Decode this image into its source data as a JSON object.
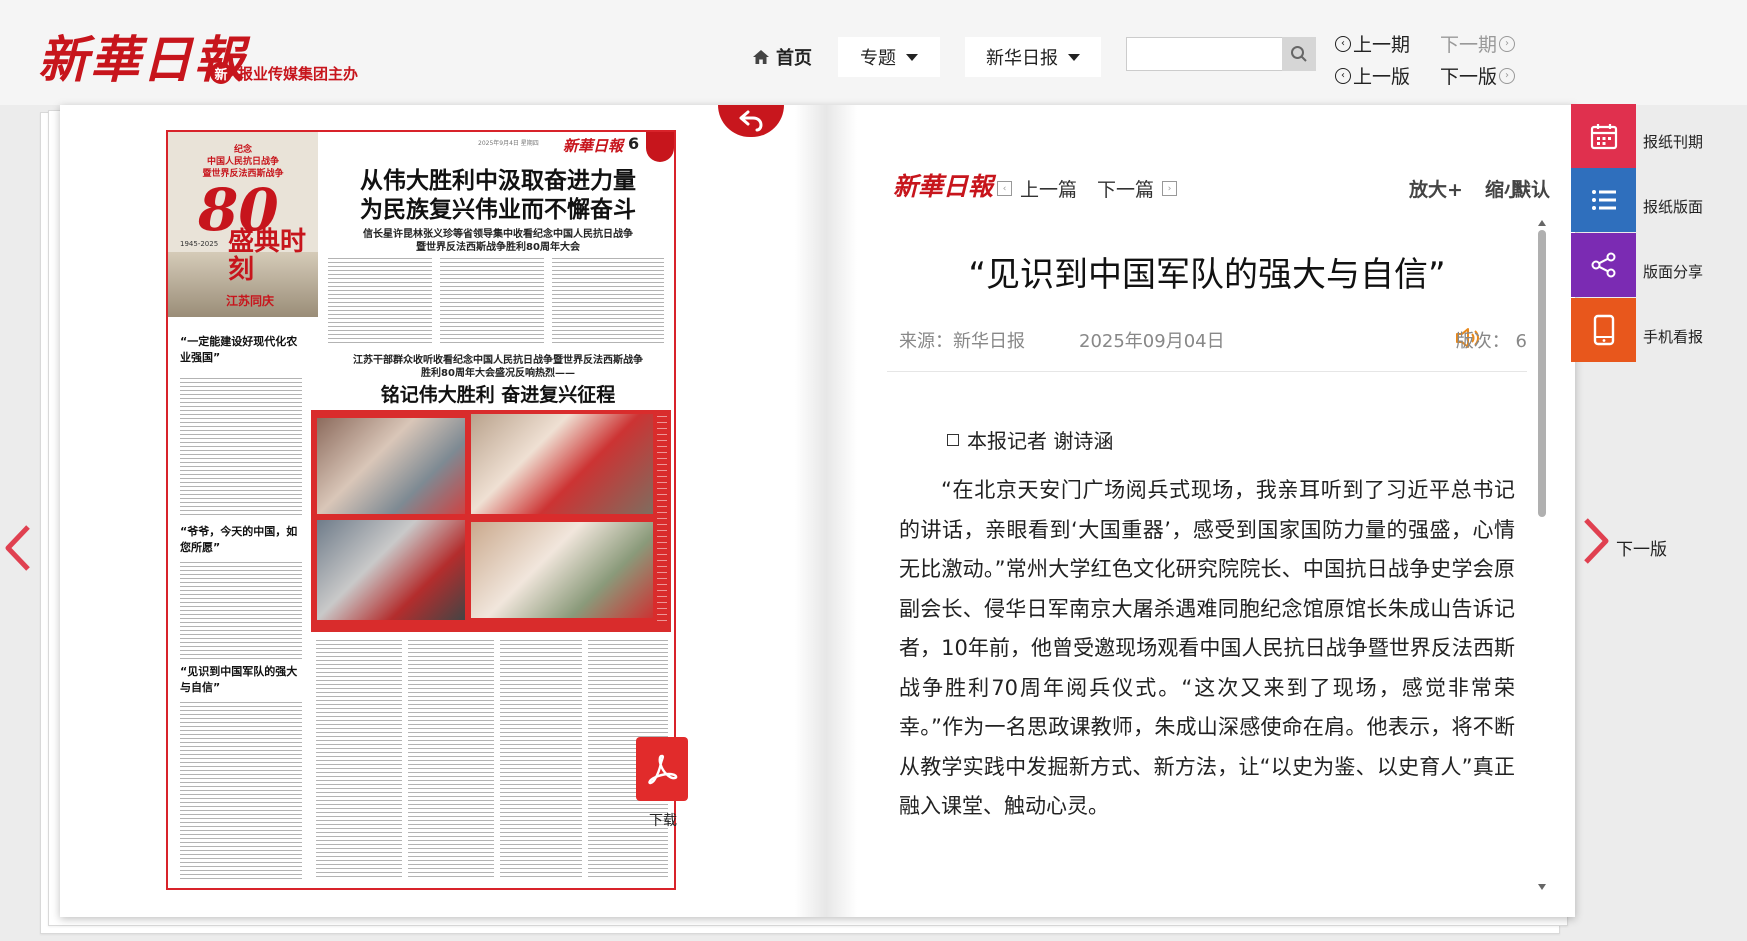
{
  "header": {
    "logo_text": "新華日報",
    "group_mark": "新",
    "group_text": "报业传媒集团主办",
    "nav_home": "首页",
    "dropdown_topic": "专题",
    "dropdown_paper": "新华日报",
    "search_placeholder": "",
    "issue": {
      "prev_issue": "上一期",
      "next_issue": "下一期",
      "prev_page": "上一版",
      "next_page": "下一版"
    }
  },
  "newspaper": {
    "page_number": "6",
    "date_line": "2025年9月4日 星期四",
    "logo_text": "新華日報",
    "sidebar_title": "纪念\n中国人民抗日战争\n暨世界反法西斯战争",
    "sidebar_number": "80",
    "sidebar_years": "1945-2025",
    "sidebar_slogan": "盛典时刻",
    "sidebar_region": "江苏同庆",
    "sub_headlines": [
      "“一定能建设好现代化农业强国”",
      "“爷爷，今天的中国，如您所愿”",
      "“见识到中国军队的强大与自信”"
    ],
    "headline1": "从伟大胜利中汲取奋进力量\n为民族复兴伟业而不懈奋斗",
    "headline1_sub": "信长星许昆林张义珍等省领导集中收看纪念中国人民抗日战争\n暨世界反法西斯战争胜利80周年大会",
    "headline2_intro": "江苏干部群众收听收看纪念中国人民抗日战争暨世界反法西斯战争\n胜利80周年大会盛况反响热烈——",
    "headline2": "铭记伟大胜利  奋进复兴征程"
  },
  "download_label": "下载",
  "article": {
    "mini_logo": "新華日報",
    "prev_article": "上一篇",
    "next_article": "下一篇",
    "zoom_in": "放大+",
    "zoom_out": "缩小-",
    "zoom_default": "默认",
    "title": "“见识到中国军队的强大与自信”",
    "source": "来源：新华日报",
    "date": "2025年09月04日",
    "page_version": "版次： 6",
    "byline": "本报记者 谢诗涵",
    "body": "“在北京天安门广场阅兵式现场，我亲耳听到了习近平总书记的讲话，亲眼看到‘大国重器’，感受到国家国防力量的强盛，心情无比激动。”常州大学红色文化研究院院长、中国抗日战争史学会原副会长、侵华日军南京大屠杀遇难同胞纪念馆原馆长朱成山告诉记者，10年前，他曾受邀现场观看中国人民抗日战争暨世界反法西斯战争胜利70周年阅兵仪式。“这次又来到了现场，感觉非常荣幸。”作为一名思政课教师，朱成山深感使命在肩。他表示，将不断从教学实践中发掘新方式、新方法，让“以史为鉴、以史育人”真正融入课堂、触动心灵。",
    "scroll_position": 0.0
  },
  "side_nav": {
    "next_label": "下一版"
  },
  "tools": {
    "items": [
      {
        "label": "报纸刊期",
        "icon": "calendar-icon",
        "color": "#e0304e"
      },
      {
        "label": "报纸版面",
        "icon": "list-icon",
        "color": "#2f6fbd"
      },
      {
        "label": "版面分享",
        "icon": "share-icon",
        "color": "#7b2bb3"
      },
      {
        "label": "手机看报",
        "icon": "mobile-icon",
        "color": "#e8571c"
      }
    ]
  },
  "colors": {
    "brand_red": "#c7151c",
    "download_red": "#e12b2b"
  }
}
